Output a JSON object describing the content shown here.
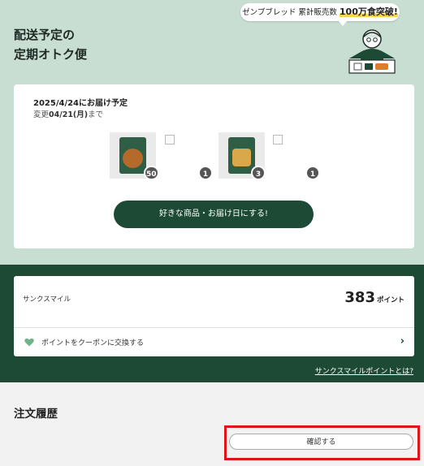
{
  "header": {
    "title_line1": "配送予定の",
    "title_line2": "定期オトク便",
    "bubble_prefix": "ゼンブブレッド 累計販売数 ",
    "bubble_highlight": "100万食突破!",
    "mascot": "mascot-illustration"
  },
  "delivery": {
    "date": "2025/4/24にお届け予定",
    "change_prefix": "変更",
    "change_date": "04/21(月)",
    "change_suffix": "まで",
    "items": [
      {
        "name": "bread-product",
        "badge": "50",
        "package_color": "#b46a2a"
      },
      {
        "name": "broken-image",
        "badge": "1"
      },
      {
        "name": "snack-product",
        "badge": "3",
        "package_color": "#d8a84a"
      },
      {
        "name": "broken-image",
        "badge": "1"
      }
    ],
    "cta_label": "好きな商品・お届け日にする!"
  },
  "points": {
    "program_name": "サンクスマイル",
    "value": "383",
    "unit": "ポイント",
    "coupon_label": "ポイントをクーポンに交換する",
    "chevron": "chevron-right-icon",
    "info_link": "サンクスマイルポイントとは?"
  },
  "orders": {
    "title": "注文履歴",
    "confirm_label": "確認する"
  },
  "colors": {
    "header_bg": "#c9ded3",
    "brand_green": "#1d4a34",
    "highlight_red": "#e0151b"
  }
}
